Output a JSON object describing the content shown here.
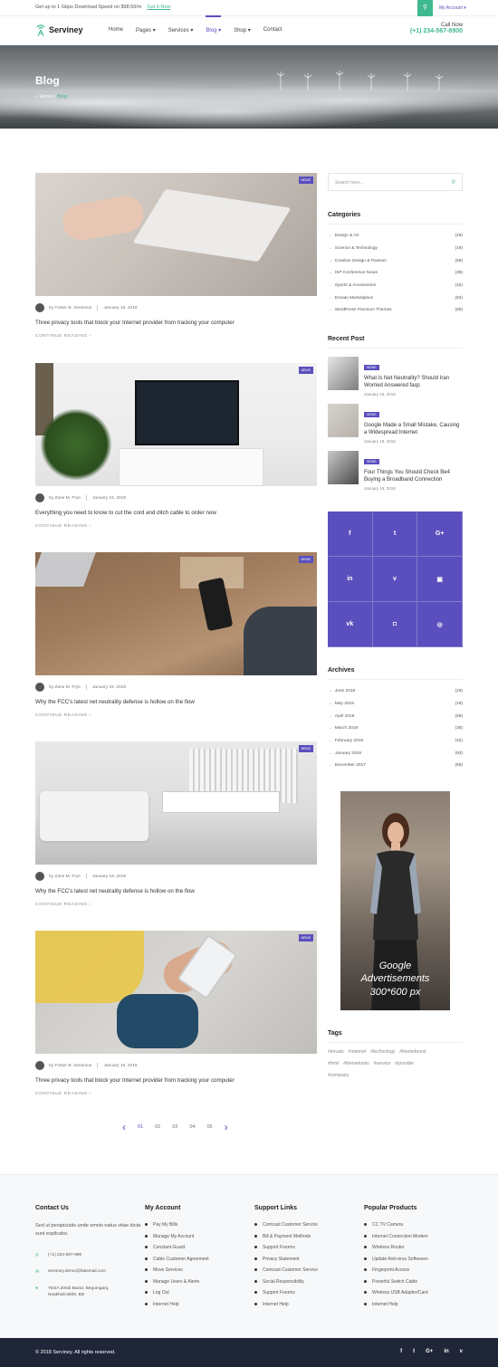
{
  "topbar": {
    "promo": "Get up to 1 Gbps Download Speed on $98.50/m",
    "promo_link": "Get It Now",
    "account": "My Account ▾"
  },
  "brand": {
    "name": "Serviney"
  },
  "nav": {
    "items": [
      "Home",
      "Pages ▾",
      "Services ▾",
      "Blog ▾",
      "Shop ▾",
      "Contact"
    ],
    "active": "Blog ▾"
  },
  "call": {
    "label": "Call Now",
    "number": "(+1) 234-567-8900"
  },
  "hero": {
    "title": "Blog",
    "crumb_home": "Home",
    "crumb_sep": "/",
    "crumb_current": "Blog"
  },
  "posts": [
    {
      "badge": "NEWS",
      "author": "by Foster B. Severson",
      "date": "January 19, 2018",
      "title": "Three privacy tools that block your Internet provider from tracking your computer",
      "more": "CONTINUE READING  ›"
    },
    {
      "badge": "NEWS",
      "author": "by Zane M. Frye",
      "date": "January 19, 2018",
      "title": "Everything you need to know to cut the cord and ditch cable to order now",
      "more": "CONTINUE READING  ›"
    },
    {
      "badge": "NEWS",
      "author": "by Zane M. Frye",
      "date": "January 19, 2018",
      "title": "Why the FCC's latest net neutrality defense is hollow on the flow",
      "more": "CONTINUE READING  ›"
    },
    {
      "badge": "NEWS",
      "author": "by Zane M. Frye",
      "date": "January 19, 2018",
      "title": "Why the FCC's latest net neutrality defense is hollow on the flow",
      "more": "CONTINUE READING  ›"
    },
    {
      "badge": "NEWS",
      "author": "by Foster B. Severson",
      "date": "January 19, 2018",
      "title": "Three privacy tools that block your Internet provider from tracking your computer",
      "more": "CONTINUE READING  ›"
    }
  ],
  "pagination": {
    "prev": "‹",
    "pages": [
      "01",
      "02",
      "03",
      "04",
      "05"
    ],
    "current": "01",
    "next": "›"
  },
  "search": {
    "placeholder": "Search here..."
  },
  "categories": {
    "title": "Categories",
    "items": [
      {
        "label": "Design & Art",
        "count": "(29)"
      },
      {
        "label": "Science & Technology",
        "count": "(18)"
      },
      {
        "label": "Creative Design & Passion",
        "count": "(59)"
      },
      {
        "label": "ISP Conference News",
        "count": "(38)"
      },
      {
        "label": "Sports & Accessories",
        "count": "(42)"
      },
      {
        "label": "Envato Marketplace",
        "count": "(93)"
      },
      {
        "label": "WordPress Premium Themes",
        "count": "(69)"
      }
    ]
  },
  "recent": {
    "title": "Recent Post",
    "items": [
      {
        "badge": "NEWS",
        "title": "What Is Net Neutrality? Should Iran Worried Answered faqs",
        "date": "January 19, 2018"
      },
      {
        "badge": "NEWS",
        "title": "Google Made a Small Mistake, Causing a Widespread Internet",
        "date": "January 19, 2018"
      },
      {
        "badge": "NEWS",
        "title": "Four Things You Should Check Be4 Buying a Broadband Connection",
        "date": "January 19, 2018"
      }
    ]
  },
  "social": [
    "f",
    "t",
    "G+",
    "in",
    "v",
    "▣",
    "vk",
    "◘",
    "◎"
  ],
  "archives": {
    "title": "Archives",
    "items": [
      {
        "label": "June 2018",
        "count": "(29)"
      },
      {
        "label": "May 2018",
        "count": "(18)"
      },
      {
        "label": "April 2018",
        "count": "(59)"
      },
      {
        "label": "March 2018",
        "count": "(38)"
      },
      {
        "label": "February 2018",
        "count": "(42)"
      },
      {
        "label": "January 2018",
        "count": "(93)"
      },
      {
        "label": "December 2017",
        "count": "(69)"
      }
    ]
  },
  "ad": {
    "line1": "Google",
    "line2": "Advertisements",
    "line3": "300*600 px"
  },
  "tags": {
    "title": "Tags",
    "items": [
      "#envato",
      "#internet",
      "#technology",
      "#themeforest",
      "#html",
      "#themelooks",
      "#service",
      "#provider",
      "#company"
    ]
  },
  "footer": {
    "contact": {
      "title": "Contact Us",
      "desc": "Sed ut perspiciatis unde omnis natus vitae dicta sunt explicabo.",
      "phone": "(+1) 234-567-890",
      "email": "serviney.demo@fakemail.com",
      "address": "784/A Zirtoli Bazar, Begumganj, Noakhali-3600, BD"
    },
    "account": {
      "title": "My Account",
      "items": [
        "Pay My Bills",
        "Manage My Account",
        "Constant Guard",
        "Cable Customer Agreement",
        "Move Services",
        "Manage Users & Alerts",
        "Log Out",
        "Internet Help"
      ]
    },
    "support": {
      "title": "Support Links",
      "items": [
        "Comcast Customer Service",
        "Bill & Payment Methods",
        "Support Forums",
        "Privacy Statement",
        "Comcast Customer Service",
        "Social Responsibility",
        "Support Forums",
        "Internet Help"
      ]
    },
    "products": {
      "title": "Popular Products",
      "items": [
        "CC TV Camera",
        "Internet Connection Modem",
        "Wireless Router",
        "Update Anti-virus Softwares",
        "Fingerprint Access",
        "Powerful Switch Cable",
        "Wireless USB Adapter/Card",
        "Internet Help"
      ]
    }
  },
  "bottom": {
    "copyright": "© 2018 Serviney. All rights reserved.",
    "social": [
      "f",
      "t",
      "G+",
      "in",
      "v"
    ]
  },
  "colors": {
    "accent": "#5a4fbd",
    "green": "#3fb98e",
    "footer_dark": "#1f2637"
  }
}
